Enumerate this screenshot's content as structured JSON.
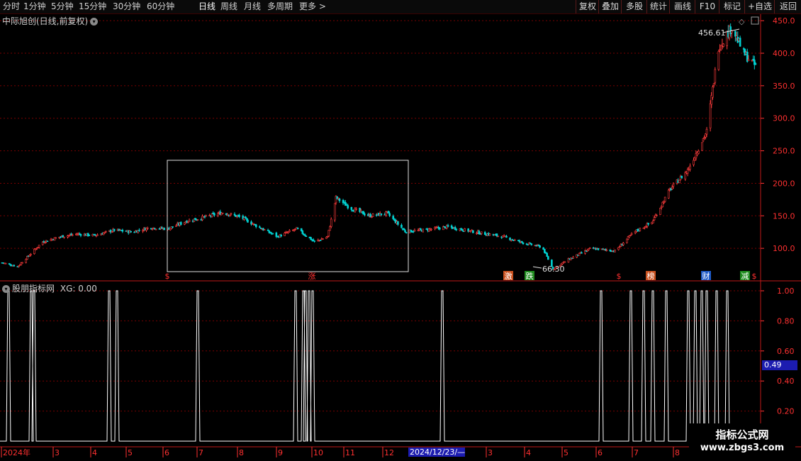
{
  "toolbar": {
    "periods": [
      "分时",
      "1分钟",
      "5分钟",
      "15分钟",
      "30分钟",
      "60分钟",
      "日线",
      "周线",
      "月线",
      "多周期",
      "更多 >"
    ],
    "active": "日线",
    "right_buttons": [
      "复权",
      "叠加",
      "多股",
      "统计",
      "画线",
      "F10",
      "标记",
      "+自选",
      "返回"
    ]
  },
  "stock": {
    "title": "中际旭创(日线,前复权)",
    "title_icon": "chevron-down-icon"
  },
  "indicator": {
    "title": "股朋指标网",
    "xg_text": "XG: 0.00",
    "icon": "chevron-down-icon"
  },
  "price_axis": {
    "labels": [
      "450.0",
      "400.0",
      "350.0",
      "300.0",
      "250.0",
      "200.0",
      "150.0",
      "100.0"
    ]
  },
  "indicator_axis": {
    "labels": [
      "1.00",
      "0.80",
      "0.60",
      "0.40",
      "0.20"
    ],
    "current_value": "0.49"
  },
  "time_axis": {
    "labels": [
      "2024年",
      "3",
      "4",
      "5",
      "6",
      "7",
      "8",
      "9",
      "10",
      "11",
      "12",
      "3",
      "4",
      "5",
      "6",
      "7",
      "8"
    ],
    "cursor_date": "2024/12/23/—"
  },
  "annotations": {
    "high_label": "456.61",
    "low_label": "66.30"
  },
  "markers": [
    {
      "text": "$",
      "color": "#ff3030"
    },
    {
      "text": "涨",
      "color": "#ff3030"
    },
    {
      "text": "激",
      "color": "#ffffff",
      "bg": "#c8501e"
    },
    {
      "text": "跌",
      "color": "#ffffff",
      "bg": "#1e8c1e"
    },
    {
      "text": "$",
      "color": "#ff3030"
    },
    {
      "text": "榜",
      "color": "#ffffff",
      "bg": "#c8501e"
    },
    {
      "text": "财",
      "color": "#ffffff",
      "bg": "#1e5ac8"
    },
    {
      "text": "减",
      "color": "#ffffff",
      "bg": "#1e8c1e"
    },
    {
      "text": "$",
      "color": "#ff3030"
    }
  ],
  "watermark": {
    "line1": "指标公式网",
    "line2": "www.zbgs3.com"
  },
  "colors": {
    "up": "#ff3c3c",
    "down": "#00d2d2",
    "grid": "#7a0000",
    "axis": "#ff3030",
    "signal": "#ffffff"
  },
  "chart_data": {
    "type": "candlestick",
    "price_min": 50,
    "price_max": 460,
    "signal_values": [
      0,
      1
    ],
    "close_series": [
      [
        "2024-01-02",
        78
      ],
      [
        "2024-01-15",
        72
      ],
      [
        "2024-01-25",
        90
      ],
      [
        "2024-02-05",
        110
      ],
      [
        "2024-02-20",
        118
      ],
      [
        "2024-03-05",
        122
      ],
      [
        "2024-03-20",
        120
      ],
      [
        "2024-04-05",
        128
      ],
      [
        "2024-04-20",
        125
      ],
      [
        "2024-05-05",
        132
      ],
      [
        "2024-05-20",
        130
      ],
      [
        "2024-06-05",
        142
      ],
      [
        "2024-06-20",
        148
      ],
      [
        "2024-07-05",
        155
      ],
      [
        "2024-07-20",
        148
      ],
      [
        "2024-08-05",
        132
      ],
      [
        "2024-08-20",
        118
      ],
      [
        "2024-09-05",
        130
      ],
      [
        "2024-09-20",
        110
      ],
      [
        "2024-10-01",
        118
      ],
      [
        "2024-10-08",
        178
      ],
      [
        "2024-10-20",
        162
      ],
      [
        "2024-11-05",
        150
      ],
      [
        "2024-11-20",
        154
      ],
      [
        "2024-12-05",
        126
      ],
      [
        "2024-12-20",
        128
      ],
      [
        "2025-01-10",
        133
      ],
      [
        "2025-02-05",
        124
      ],
      [
        "2025-02-25",
        118
      ],
      [
        "2025-03-15",
        108
      ],
      [
        "2025-03-30",
        102
      ],
      [
        "2025-04-08",
        68
      ],
      [
        "2025-04-20",
        82
      ],
      [
        "2025-05-10",
        100
      ],
      [
        "2025-05-30",
        96
      ],
      [
        "2025-06-15",
        125
      ],
      [
        "2025-06-30",
        140
      ],
      [
        "2025-07-15",
        190
      ],
      [
        "2025-07-30",
        220
      ],
      [
        "2025-08-15",
        280
      ],
      [
        "2025-08-25",
        410
      ],
      [
        "2025-09-05",
        440
      ],
      [
        "2025-09-15",
        400
      ],
      [
        "2025-09-25",
        380
      ]
    ],
    "high_value": 456.61,
    "low_value": 66.3
  }
}
